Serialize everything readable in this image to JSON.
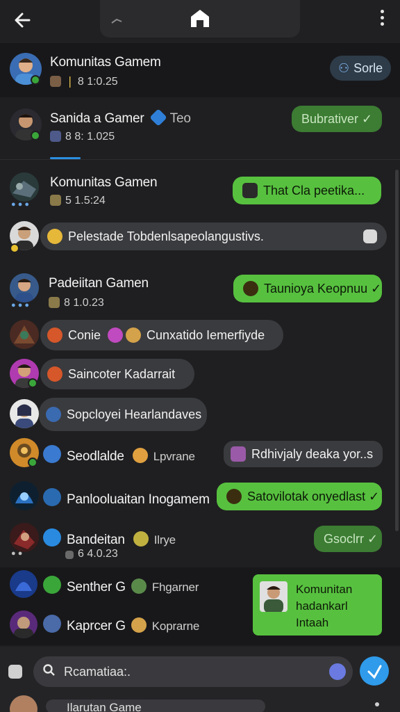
{
  "header": {
    "back_icon": "arrow-left-icon",
    "home_icon": "home-icon",
    "menu_icon": "kebab-menu-icon"
  },
  "rows": [
    {
      "name": "Komunitas Gamem",
      "sub": "8 1:0.25",
      "action": "Sorle"
    },
    {
      "name": "Sanida a Gamer",
      "extra": "Teo",
      "sub": "8 8: 1.025",
      "action": "Bubrativer ✓"
    },
    {
      "name": "Komunitas Gamen",
      "sub": "5 1.5:24",
      "message": "That Cla peetika..."
    },
    {
      "message": "Pelestade Tobdenlsapeolangustivs."
    },
    {
      "name": "Padeiitan Gamen",
      "sub": "8 1.0.23",
      "message": "Taunioya Keopnuu ✓"
    },
    {
      "name": "Conie",
      "extra": "Cunxatido Iemerfiyde"
    },
    {
      "name": "Saincoter Kadarrait"
    },
    {
      "name": "Sopcloyei Hearlandaves"
    },
    {
      "name": "Seodlalde",
      "extra": "Lpvrane",
      "message": "Rdhivjaly deaka yor..s"
    },
    {
      "name": "Panlooluaitan Inogamem",
      "message": "Satovilotak onyedlast ✓"
    },
    {
      "name": "Bandeitan",
      "extra": "Ilrye",
      "sub": "6 4.0.23",
      "message": "Gsoclrr ✓"
    },
    {
      "name": "Senther G",
      "extra": "Fhgarner"
    },
    {
      "name": "Kaprcer G",
      "extra": "Koprarne"
    }
  ],
  "popup": {
    "text": "Komunitan hadankarl Intaah"
  },
  "search": {
    "placeholder": "Rcamatiaa:."
  },
  "bottom_peek": {
    "text": "Ilarutan Game"
  }
}
